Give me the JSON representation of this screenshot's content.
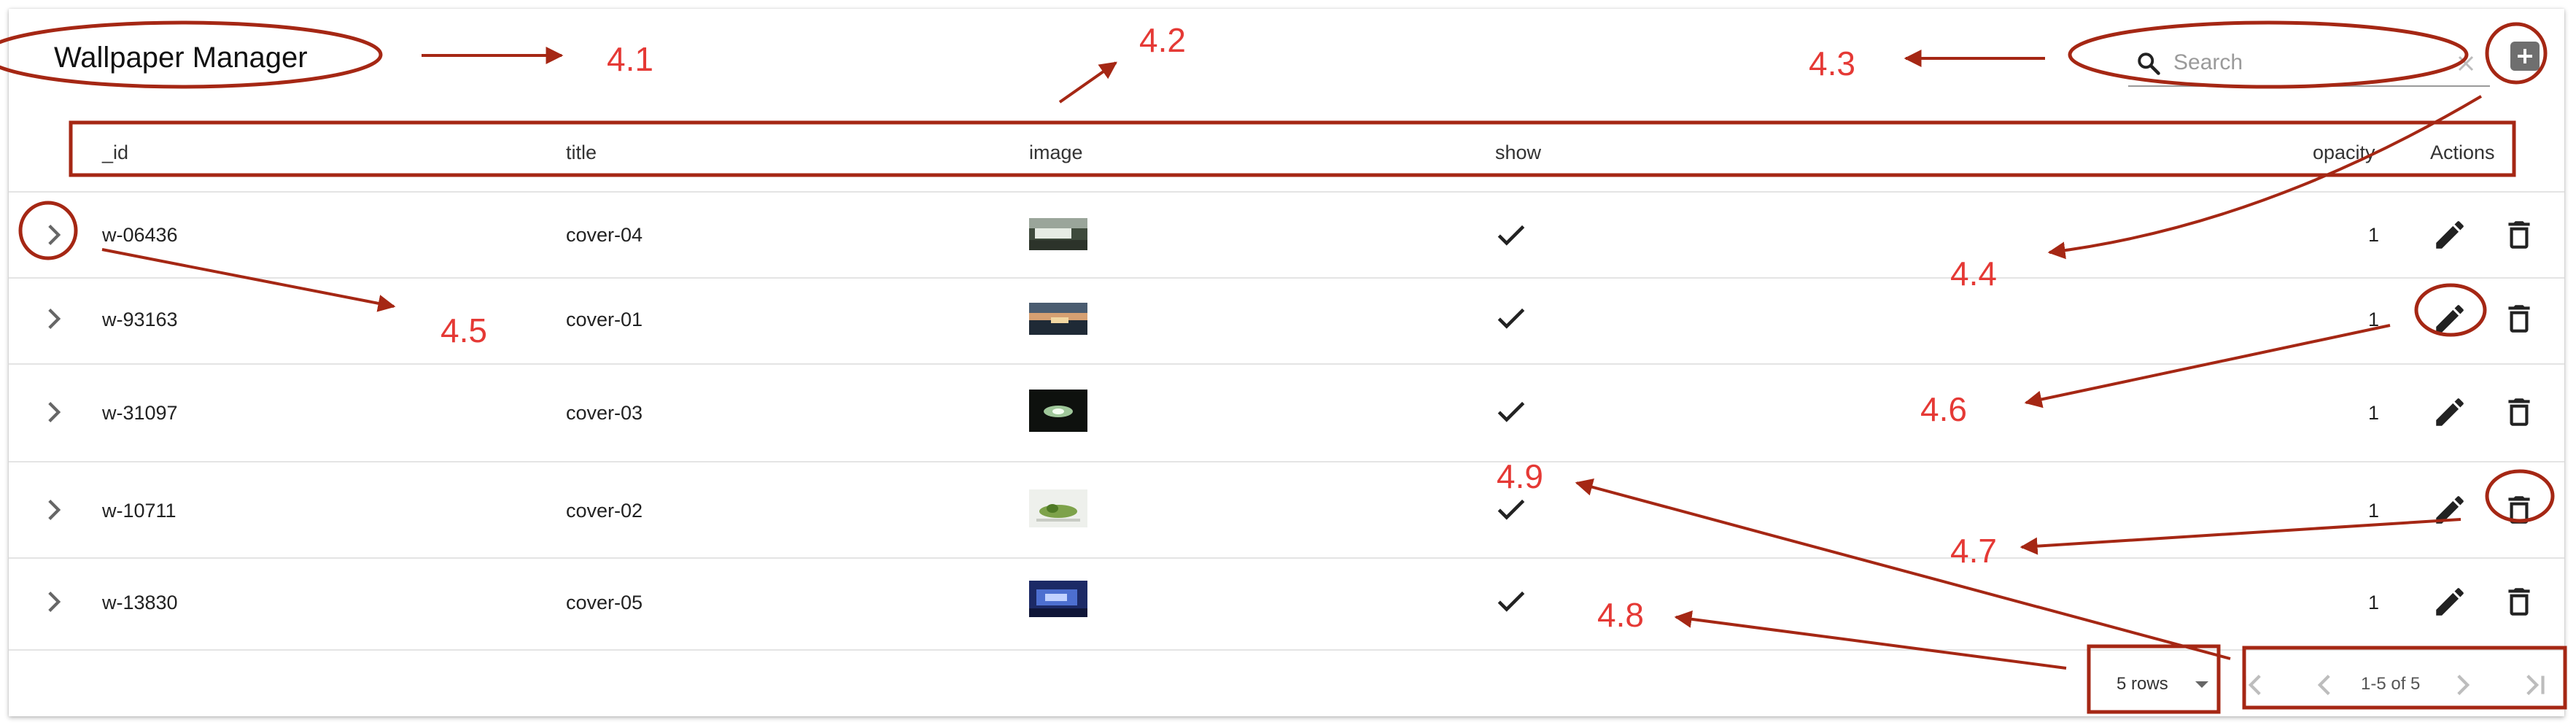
{
  "app": {
    "title": "Wallpaper Manager"
  },
  "search": {
    "placeholder": "Search",
    "value": ""
  },
  "table": {
    "columns": [
      "_id",
      "title",
      "image",
      "show",
      "opacity",
      "Actions"
    ],
    "rows": [
      {
        "id": "w-06436",
        "title": "cover-04",
        "show": true,
        "opacity": "1"
      },
      {
        "id": "w-93163",
        "title": "cover-01",
        "show": true,
        "opacity": "1"
      },
      {
        "id": "w-31097",
        "title": "cover-03",
        "show": true,
        "opacity": "1"
      },
      {
        "id": "w-10711",
        "title": "cover-02",
        "show": true,
        "opacity": "1"
      },
      {
        "id": "w-13830",
        "title": "cover-05",
        "show": true,
        "opacity": "1"
      }
    ]
  },
  "pagination": {
    "rows_per_page": "5 rows",
    "range": "1-5 of 5"
  },
  "annotations": [
    "4.1",
    "4.2",
    "4.3",
    "4.4",
    "4.5",
    "4.6",
    "4.7",
    "4.8",
    "4.9"
  ],
  "colors": {
    "annotation": "#e53935",
    "annotation_outline": "#a52714",
    "add_button": "#6f6f6f"
  },
  "icons": {
    "search": "search-icon",
    "clear": "close-icon",
    "add": "add-box-icon",
    "expand": "chevron-right-icon",
    "edit": "pencil-icon",
    "delete": "trash-icon",
    "show": "check-icon",
    "dropdown": "caret-down-icon",
    "first": "first-page-icon",
    "prev": "chevron-left-icon",
    "next": "chevron-right-icon",
    "last": "last-page-icon"
  }
}
